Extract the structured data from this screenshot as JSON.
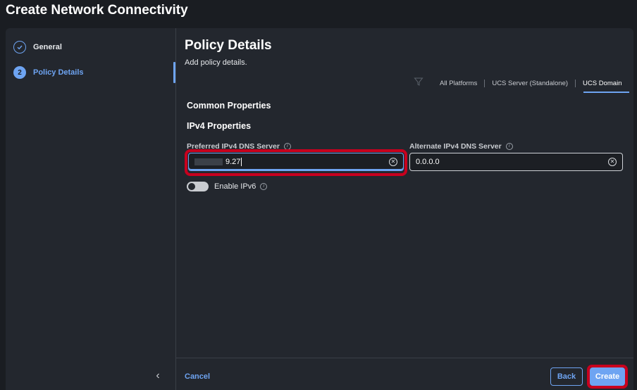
{
  "window": {
    "title": "Create Network Connectivity"
  },
  "wizard": {
    "steps": [
      {
        "number": "",
        "label": "General",
        "state": "completed",
        "icon": "check-icon"
      },
      {
        "number": "2",
        "label": "Policy Details",
        "state": "active"
      }
    ]
  },
  "main": {
    "title": "Policy Details",
    "subtitle": "Add policy details.",
    "platform_tabs": [
      "All Platforms",
      "UCS Server (Standalone)",
      "UCS Domain"
    ],
    "active_platform_tab": "UCS Domain",
    "sections": {
      "common": "Common Properties",
      "ipv4": "IPv4 Properties"
    },
    "fields": {
      "preferred_dns": {
        "label": "Preferred IPv4 DNS Server",
        "value": "9.27"
      },
      "alternate_dns": {
        "label": "Alternate IPv4 DNS Server",
        "value": "0.0.0.0"
      }
    },
    "enable_ipv6": {
      "label": "Enable IPv6",
      "enabled": false
    }
  },
  "footer": {
    "cancel": "Cancel",
    "back": "Back",
    "create": "Create"
  },
  "colors": {
    "accent": "#6ea4f2",
    "highlight": "#c8001e",
    "background": "#1a1d22",
    "panel": "#23272e"
  }
}
